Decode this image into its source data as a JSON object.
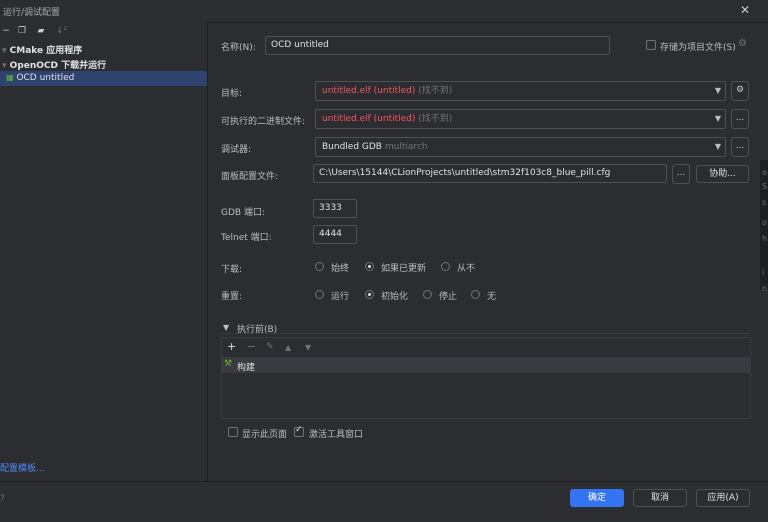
{
  "window": {
    "title": "运行/调试配置",
    "close_glyph": "✕"
  },
  "left_toolbar": {
    "icons": [
      "minus-icon",
      "copy-icon",
      "folder-add-icon",
      "sort-icon"
    ]
  },
  "tree": {
    "items": [
      {
        "label": "CMake 应用程序",
        "bold": true
      },
      {
        "label": "OpenOCD 下载并运行",
        "bold": true
      },
      {
        "label": "OCD untitled",
        "bold": false,
        "selected": true
      }
    ],
    "template_link": "配置模板..."
  },
  "form": {
    "name_label": "名称(N):",
    "name_value": "OCD untitled",
    "store_label": "存储为项目文件(S)",
    "target_label": "目标:",
    "target_value": "untitled.elf (untitled)",
    "target_hint": "(找不到)",
    "exe_label": "可执行的二进制文件:",
    "exe_value": "untitled.elf (untitled)",
    "exe_hint": "(找不到)",
    "debugger_label": "调试器:",
    "debugger_value": "Bundled GDB",
    "debugger_hint": "multiarch",
    "board_label": "面板配置文件:",
    "board_value": "C:\\Users\\15144\\CLionProjects\\untitled\\stm32f103c8_blue_pill.cfg",
    "browse_label": "...",
    "assist_label": "协助...",
    "gdb_port_label": "GDB 端口:",
    "gdb_port_value": "3333",
    "telnet_port_label": "Telnet 端口:",
    "telnet_port_value": "4444",
    "download_label": "下载:",
    "download_options": [
      "始终",
      "如果已更新",
      "从不"
    ],
    "download_selected": "如果已更新",
    "reset_label": "重置:",
    "reset_options": [
      "运行",
      "初始化",
      "停止",
      "无"
    ],
    "reset_selected": "初始化"
  },
  "before_launch": {
    "title": "执行前(B)",
    "toolbar": [
      "add-icon",
      "remove-icon",
      "edit-icon",
      "up-icon",
      "down-icon"
    ],
    "items": [
      "构建"
    ]
  },
  "options": {
    "show_page_label": "显示此页面",
    "show_page_checked": false,
    "activate_tool_label": "激活工具窗口",
    "activate_tool_checked": true
  },
  "buttons": {
    "ok": "确定",
    "cancel": "取消",
    "apply": "应用(A)"
  },
  "right_strip": [
    "o",
    "S",
    "s",
    "o",
    "h",
    "i",
    "n"
  ],
  "colors": {
    "accent": "#3574f0",
    "error": "#f75464",
    "selected_row": "#2e436e"
  }
}
